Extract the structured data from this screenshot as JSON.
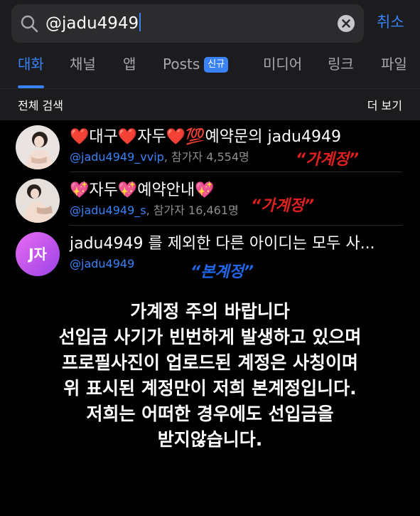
{
  "search": {
    "query": "@jadu4949",
    "cancel_label": "취소"
  },
  "tabs": [
    {
      "label": "대화",
      "active": true
    },
    {
      "label": "채널"
    },
    {
      "label": "앱"
    },
    {
      "label": "Posts",
      "badge": "신규"
    },
    {
      "label": "미디어"
    },
    {
      "label": "링크"
    },
    {
      "label": "파일"
    }
  ],
  "section": {
    "title": "전체 검색",
    "more_label": "더 보기"
  },
  "results": [
    {
      "title": "❤️대구❤️자두❤️💯예약문의 jadu4949",
      "handle": "@jadu4949_vvip",
      "meta": ", 참가자 4,554명",
      "annotation": "“가계정”"
    },
    {
      "title": "💖자두💖예약안내💖",
      "handle": "@jadu4949_s",
      "meta": ", 참가자 16,461명",
      "annotation": "“가계정”"
    },
    {
      "avatar_text": "J자",
      "title": "jadu4949 를 제외한 다른 아이디는 모두 사...",
      "handle": "@jadu4949",
      "meta": "",
      "annotation": "“본계정”"
    }
  ],
  "notice": {
    "lines": [
      "가계정 주의 바랍니다",
      "선입금 사기가 빈번하게 발생하고 있으며",
      "프로필사진이 업로드된 계정은 사칭이며",
      "위 표시된 계정만이 저희 본계정입니다.",
      "저희는 어떠한 경우에도 선입금을",
      "받지않습니다."
    ]
  },
  "colors": {
    "accent": "#3a82f7",
    "warning": "#e02020",
    "official": "#2166e8"
  }
}
